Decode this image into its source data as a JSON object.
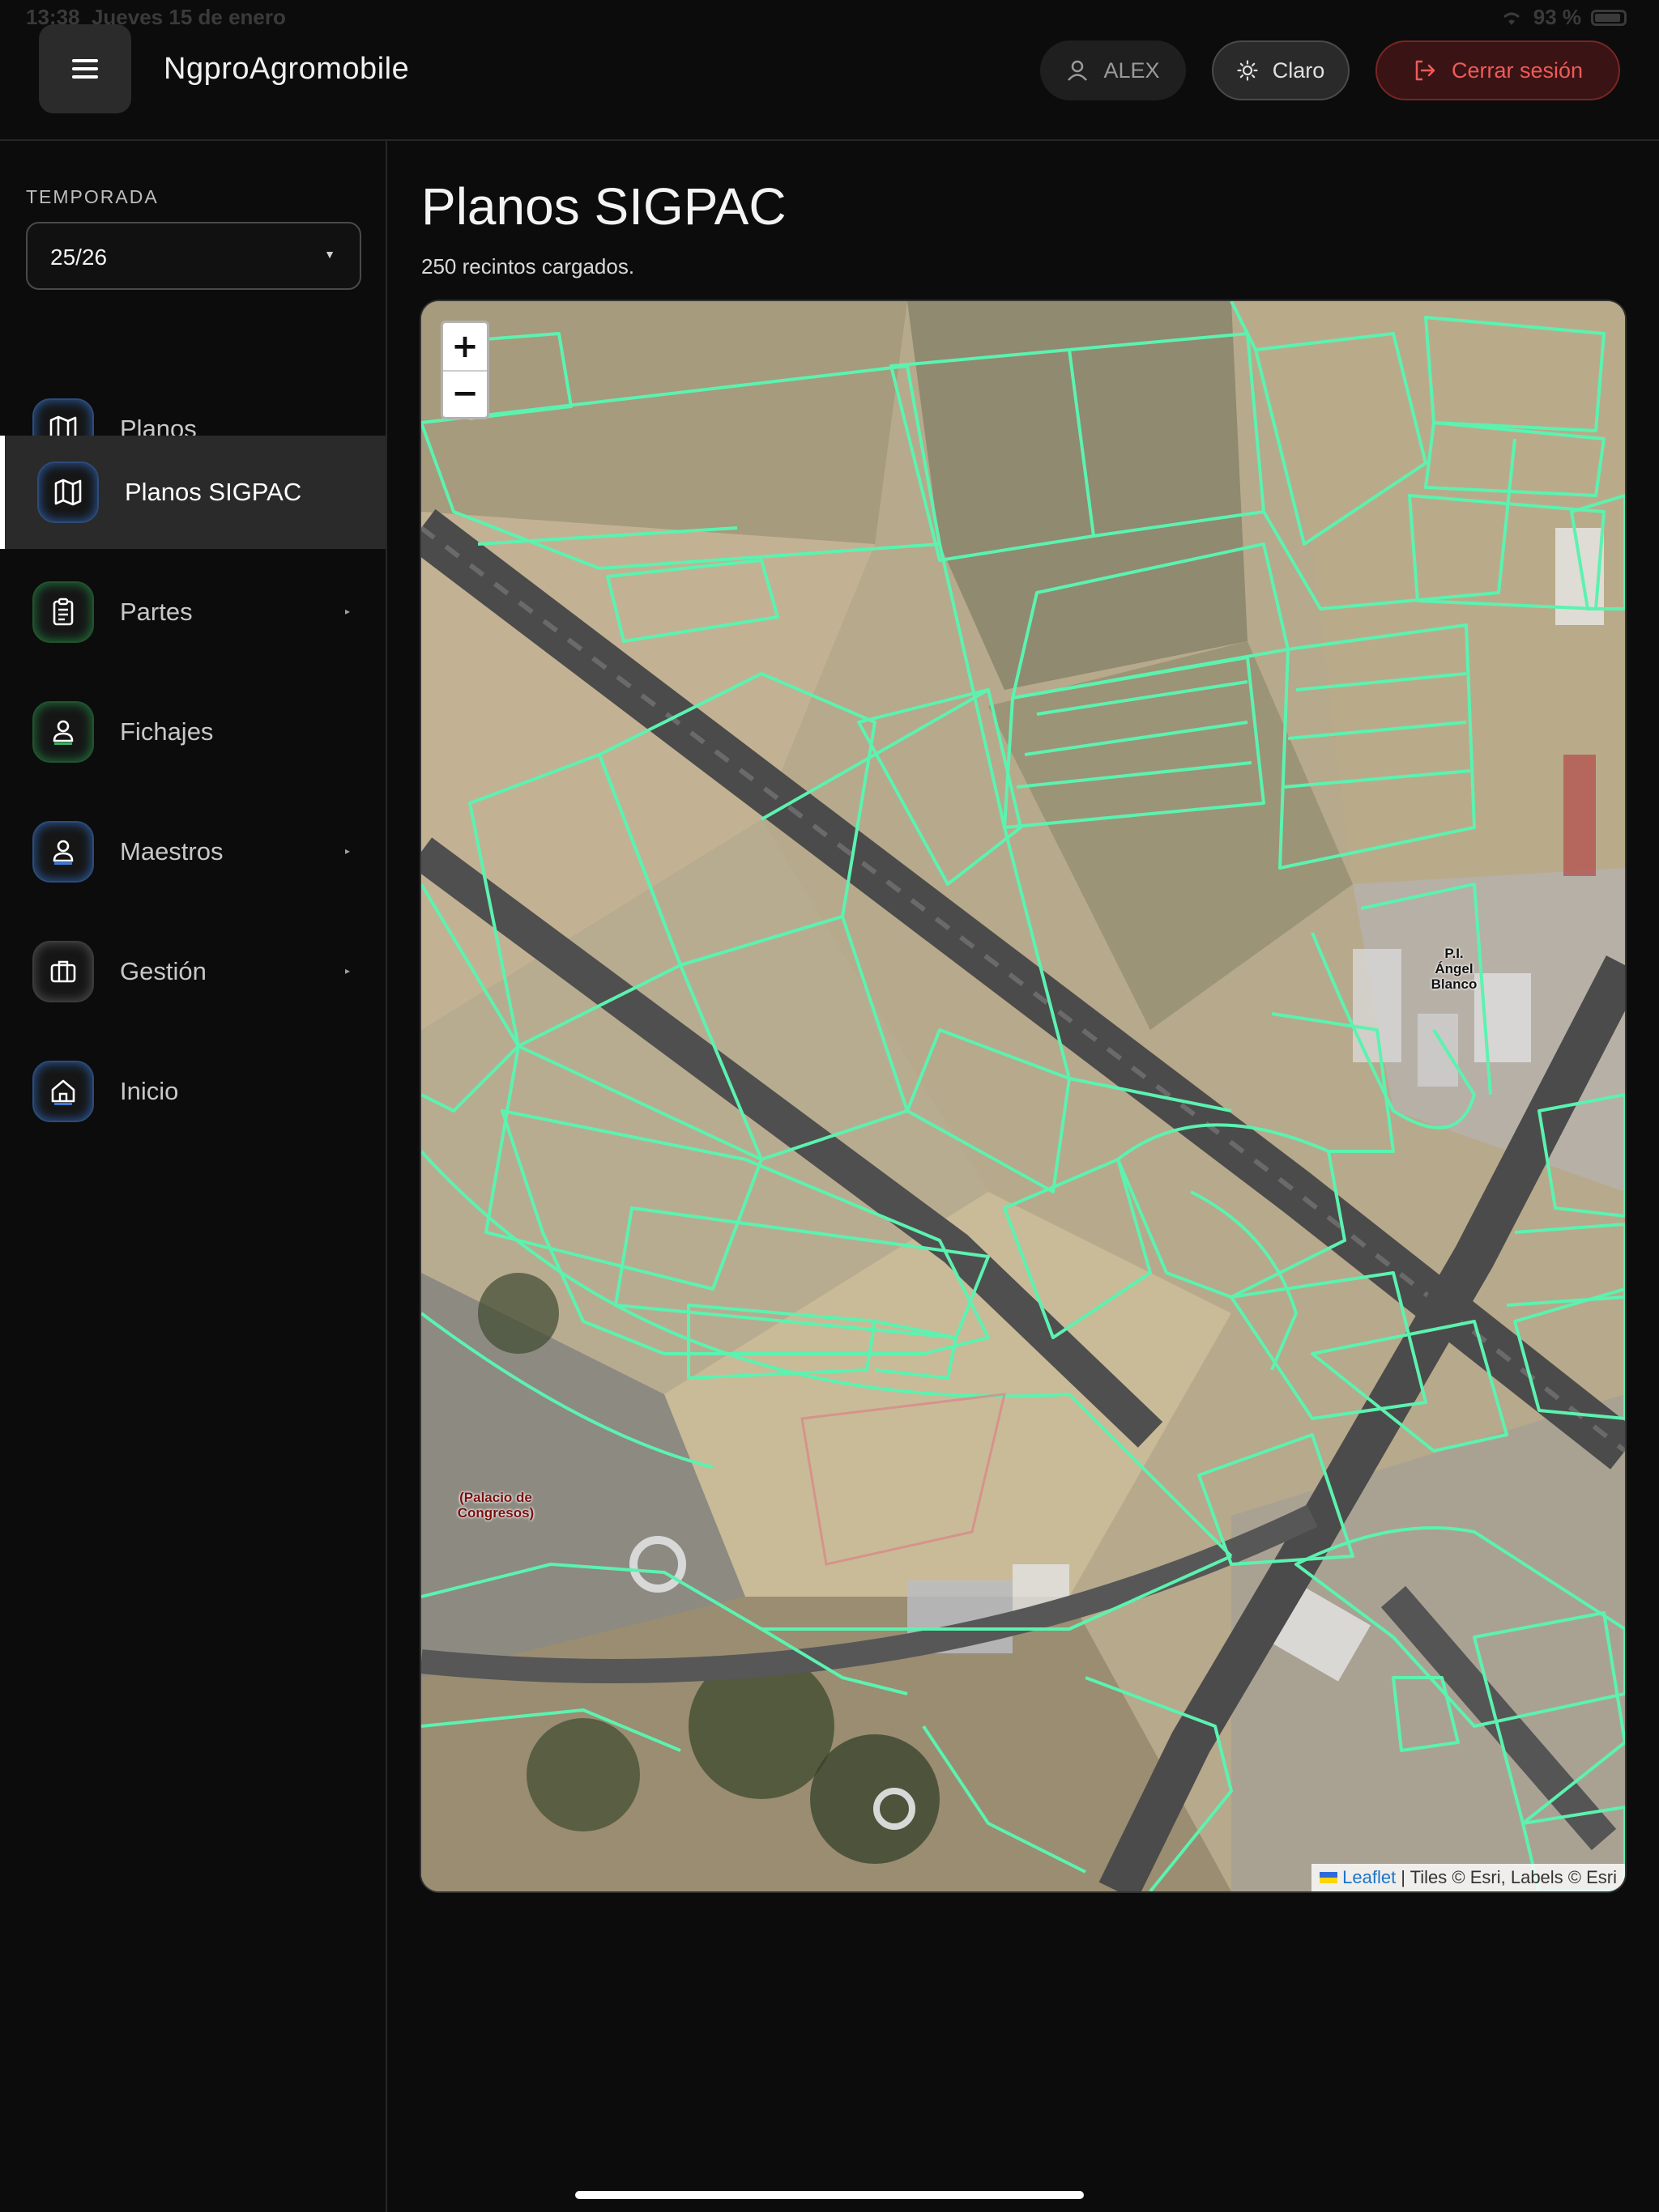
{
  "status": {
    "time": "13:38",
    "date": "Jueves 15 de enero",
    "battery": "93 %"
  },
  "header": {
    "app_title": "NgproAgromobile",
    "user_label": "ALEX",
    "theme_label": "Claro",
    "logout_label": "Cerrar sesión"
  },
  "sidebar": {
    "season_label": "TEMPORADA",
    "season_value": "25/26",
    "items": [
      {
        "label": "Planos",
        "icon": "map-icon",
        "active": false,
        "expandable": false
      },
      {
        "label": "Planos SIGPAC",
        "icon": "map-icon",
        "active": true,
        "expandable": false
      },
      {
        "label": "Partes",
        "icon": "clipboard-icon",
        "active": false,
        "expandable": true
      },
      {
        "label": "Fichajes",
        "icon": "person-icon",
        "active": false,
        "expandable": false
      },
      {
        "label": "Maestros",
        "icon": "person-icon",
        "active": false,
        "expandable": true
      },
      {
        "label": "Gestión",
        "icon": "briefcase-icon",
        "active": false,
        "expandable": true
      },
      {
        "label": "Inicio",
        "icon": "home-icon",
        "active": false,
        "expandable": false
      }
    ]
  },
  "main": {
    "title": "Planos SIGPAC",
    "subtitle": "250 recintos cargados.",
    "map": {
      "zoom_in": "+",
      "zoom_out": "−",
      "labels": {
        "palacio": "(Palacio de Congresos)",
        "poligono": "P.I. Ángel Blanco"
      },
      "attribution": {
        "link": "Leaflet",
        "rest": "| Tiles © Esri, Labels © Esri"
      },
      "parcel_color": "#5cf2b0"
    }
  },
  "colors": {
    "accent_logout": "#ef5a5a",
    "background": "#0c0c0c"
  }
}
